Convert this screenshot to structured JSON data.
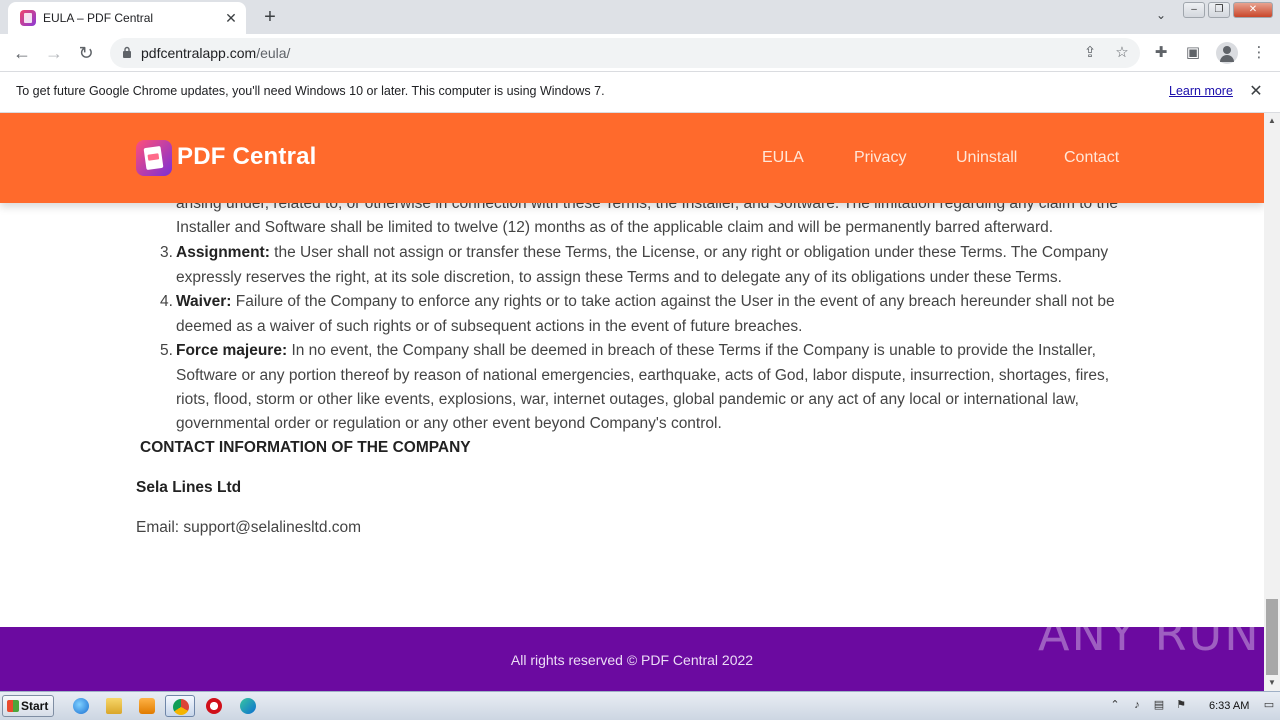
{
  "browser": {
    "tab_title": "EULA – PDF Central",
    "url_domain": "pdfcentralapp.com",
    "url_path": "/eula/",
    "infobar_text": "To get future Google Chrome updates, you'll need Windows 10 or later. This computer is using Windows 7.",
    "infobar_link": "Learn more"
  },
  "site": {
    "logo_text": "PDF Central",
    "nav": [
      "EULA",
      "Privacy",
      "Uninstall",
      "Contact"
    ],
    "brand_color": "#ff6a2c",
    "footer_color": "#6b0aa0"
  },
  "content": {
    "partial_lines": [
      "arising under, related to, or otherwise in connection with these Terms, the Installer, and Software. The limitation regarding any claim to the",
      "Installer and Software shall be limited to twelve (12) months as of the applicable claim and will be permanently barred afterward."
    ],
    "items": [
      {
        "number": "3.",
        "title": "Assignment:",
        "lines": [
          " the User shall not assign or transfer these Terms, the License, or any right or obligation under these Terms. The Company",
          "expressly reserves the right, at its sole discretion, to assign these Terms and to delegate any of its obligations under these Terms."
        ]
      },
      {
        "number": "4.",
        "title": "Waiver:",
        "lines": [
          " Failure of the Company to enforce any rights or to take action against the User in the event of any breach hereunder shall not be",
          "deemed as a waiver of such rights or of subsequent actions in the event of future breaches."
        ]
      },
      {
        "number": "5.",
        "title": "Force majeure:",
        "lines": [
          " In no event, the Company shall be deemed in breach of these Terms if the Company is unable to provide the Installer,",
          "Software or any portion thereof by reason of national emergencies, earthquake, acts of God, labor dispute, insurrection, shortages, fires,",
          "riots, flood, storm or other like events, explosions, war, internet outages, global pandemic or any act of any local or international law,",
          "governmental order or regulation or any other event beyond Company's control."
        ]
      }
    ],
    "contact_heading": "CONTACT INFORMATION OF THE COMPANY",
    "company_name": "Sela Lines Ltd",
    "email_line": "Email: support@selalinesltd.com"
  },
  "footer": {
    "text": "All rights reserved © PDF Central 2022"
  },
  "watermark": "ANY RUN",
  "taskbar": {
    "start_label": "Start",
    "clock": "6:33 AM"
  }
}
